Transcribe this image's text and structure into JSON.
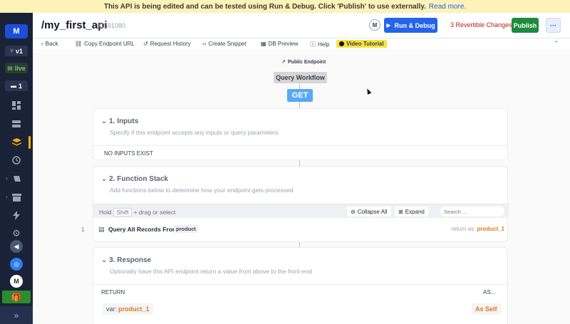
{
  "banner": {
    "message": "This API is being edited and can be tested using Run & Debug. Click 'Publish' to use externally.",
    "link": "Read more."
  },
  "sidebar": {
    "logo": "M",
    "version": "v1",
    "status": "live",
    "branch_count": "1",
    "user_initial": "M",
    "accent_color": "#f4b400"
  },
  "header": {
    "title": "/my_first_api",
    "api_id": "#1591080",
    "avatar_initial": "M",
    "run_debug_label": "Run & Debug",
    "revertible_label": "3 Revertible Changes",
    "publish_label": "Publish",
    "more_label": "···"
  },
  "toolbar": {
    "back": "Back",
    "copy_url": "Copy Endpoint URL",
    "history": "Request History",
    "snippet": "Create Snippet",
    "db_preview": "DB Preview",
    "help": "Help",
    "video": "Video Tutorial"
  },
  "endpoint": {
    "visibility": "Public Endpoint",
    "workflow": "Query Workflow",
    "method": "GET"
  },
  "inputs": {
    "title": "1. Inputs",
    "description": "Specify if this endpoint accepts any inputs or query parameters",
    "empty": "NO INPUTS EXIST"
  },
  "function_stack": {
    "title": "2. Function Stack",
    "description": "Add functions below to determine how your endpoint gets processed",
    "hold": "Hold",
    "key": "Shift",
    "hint": "+ drag or select",
    "collapse_all": "Collapse All",
    "expand": "Expand",
    "search_placeholder": "Search ...",
    "items": [
      {
        "num": "1",
        "name": "Query All Records From",
        "table": "product",
        "return_prefix": "return as",
        "return_var": "product_1"
      }
    ]
  },
  "response": {
    "title": "3. Response",
    "description": "Optionally have this API endpoint return a value from above to the front-end",
    "col_return": "RETURN",
    "col_as": "AS...",
    "var_prefix": "var:",
    "var_name": "product_1",
    "as_value": "As Self"
  }
}
